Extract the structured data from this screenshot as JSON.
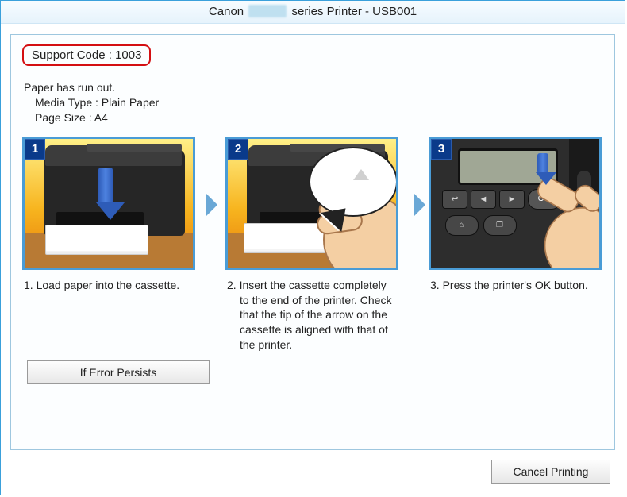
{
  "window": {
    "title_prefix": "Canon",
    "title_suffix": "series Printer - USB001"
  },
  "support": {
    "label": "Support Code : ",
    "code": "1003"
  },
  "error": {
    "headline": "Paper has run out.",
    "media_type_label": "Media Type : ",
    "media_type_value": "Plain Paper",
    "page_size_label": "Page Size : ",
    "page_size_value": "A4"
  },
  "steps": {
    "s1": {
      "num": "1",
      "caption": "1.  Load paper into the cassette."
    },
    "s2": {
      "num": "2",
      "caption_lead": "2.  Insert the cassette completely",
      "caption_rest": "to the end of the printer. Check that the tip of the arrow on the cassette is aligned with that of the printer."
    },
    "s3": {
      "num": "3",
      "caption": "3.  Press the printer's OK button."
    }
  },
  "panel_labels": {
    "back": "↩",
    "left": "◄",
    "right": "►",
    "ok": "OK",
    "home": "⌂",
    "doc": "❐"
  },
  "buttons": {
    "if_error_persists": "If Error Persists",
    "cancel_printing": "Cancel Printing"
  }
}
